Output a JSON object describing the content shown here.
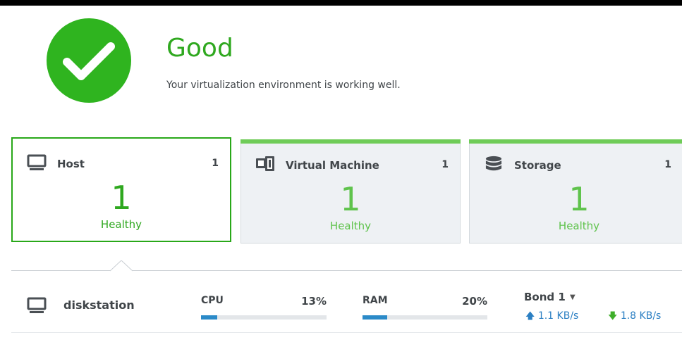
{
  "status": {
    "title": "Good",
    "description": "Your virtualization environment is working well.",
    "color": "#2fb41f",
    "icon": "checkmark-icon"
  },
  "cards": [
    {
      "label": "Host",
      "count": "1",
      "big": "1",
      "health": "Healthy",
      "icon": "monitor-icon",
      "selected": true
    },
    {
      "label": "Virtual Machine",
      "count": "1",
      "big": "1",
      "health": "Healthy",
      "icon": "virtual-machine-icon",
      "selected": false
    },
    {
      "label": "Storage",
      "count": "1",
      "big": "1",
      "health": "Healthy",
      "icon": "database-icon",
      "selected": false
    }
  ],
  "host_row": {
    "name": "diskstation",
    "cpu_label": "CPU",
    "cpu_value": "13%",
    "cpu_fraction": 0.13,
    "ram_label": "RAM",
    "ram_value": "20%",
    "ram_fraction": 0.2,
    "bond_label": "Bond 1",
    "upload": "1.1 KB/s",
    "download": "1.8 KB/s"
  },
  "colors": {
    "accent_green": "#2fb41f",
    "bar_blue": "#2b8ac8"
  }
}
